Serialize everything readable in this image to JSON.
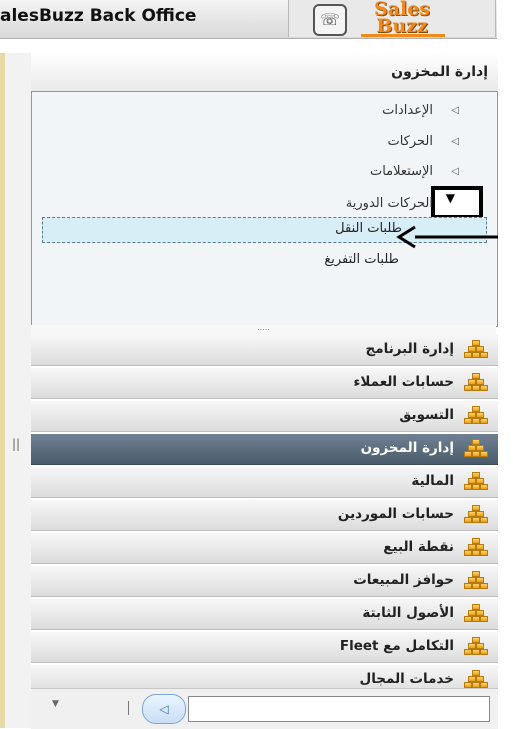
{
  "header": {
    "title": "alesBuzz Back Office",
    "logo_text": "Sales\nBuzz"
  },
  "panel": {
    "title": "إدارة المخزون",
    "tree": [
      {
        "label": "الإعدادات"
      },
      {
        "label": "الحركات"
      },
      {
        "label": "الإستعلامات"
      },
      {
        "label": "الحركات الدورية"
      }
    ],
    "sub_items": [
      {
        "label": "طلبات النقل"
      },
      {
        "label": "طلبات التفريغ"
      }
    ],
    "splitter": "....."
  },
  "nav": [
    {
      "label": "إدارة البرنامج",
      "active": false
    },
    {
      "label": "حسابات العملاء",
      "active": false
    },
    {
      "label": "التسويق",
      "active": false
    },
    {
      "label": "إدارة المخزون",
      "active": true
    },
    {
      "label": "المالية",
      "active": false
    },
    {
      "label": "حسابات الموردين",
      "active": false
    },
    {
      "label": "نقطة البيع",
      "active": false
    },
    {
      "label": "حوافز المبيعات",
      "active": false
    },
    {
      "label": "الأصول الثابتة",
      "active": false
    },
    {
      "label": "التكامل مع Fleet",
      "active": false
    },
    {
      "label": "خدمات المجال",
      "active": false
    }
  ],
  "icons": {
    "tree_item": "small-right-triangle-icon",
    "tree_expanded": "chevron-down-icon",
    "nav": "boxes-stack-icon",
    "pointer": "pointer-arrow-icon",
    "nav_back": "circle-back-icon",
    "dropdown": "dropdown-icon"
  },
  "footer": {
    "separator": "|"
  },
  "gutter": {
    "handle": "||"
  },
  "colors": {
    "active_nav": "#4a5b6c",
    "selected_item": "#d8eef6",
    "icon_gold": "#e4a019",
    "logo_orange": "#f08a1c"
  }
}
